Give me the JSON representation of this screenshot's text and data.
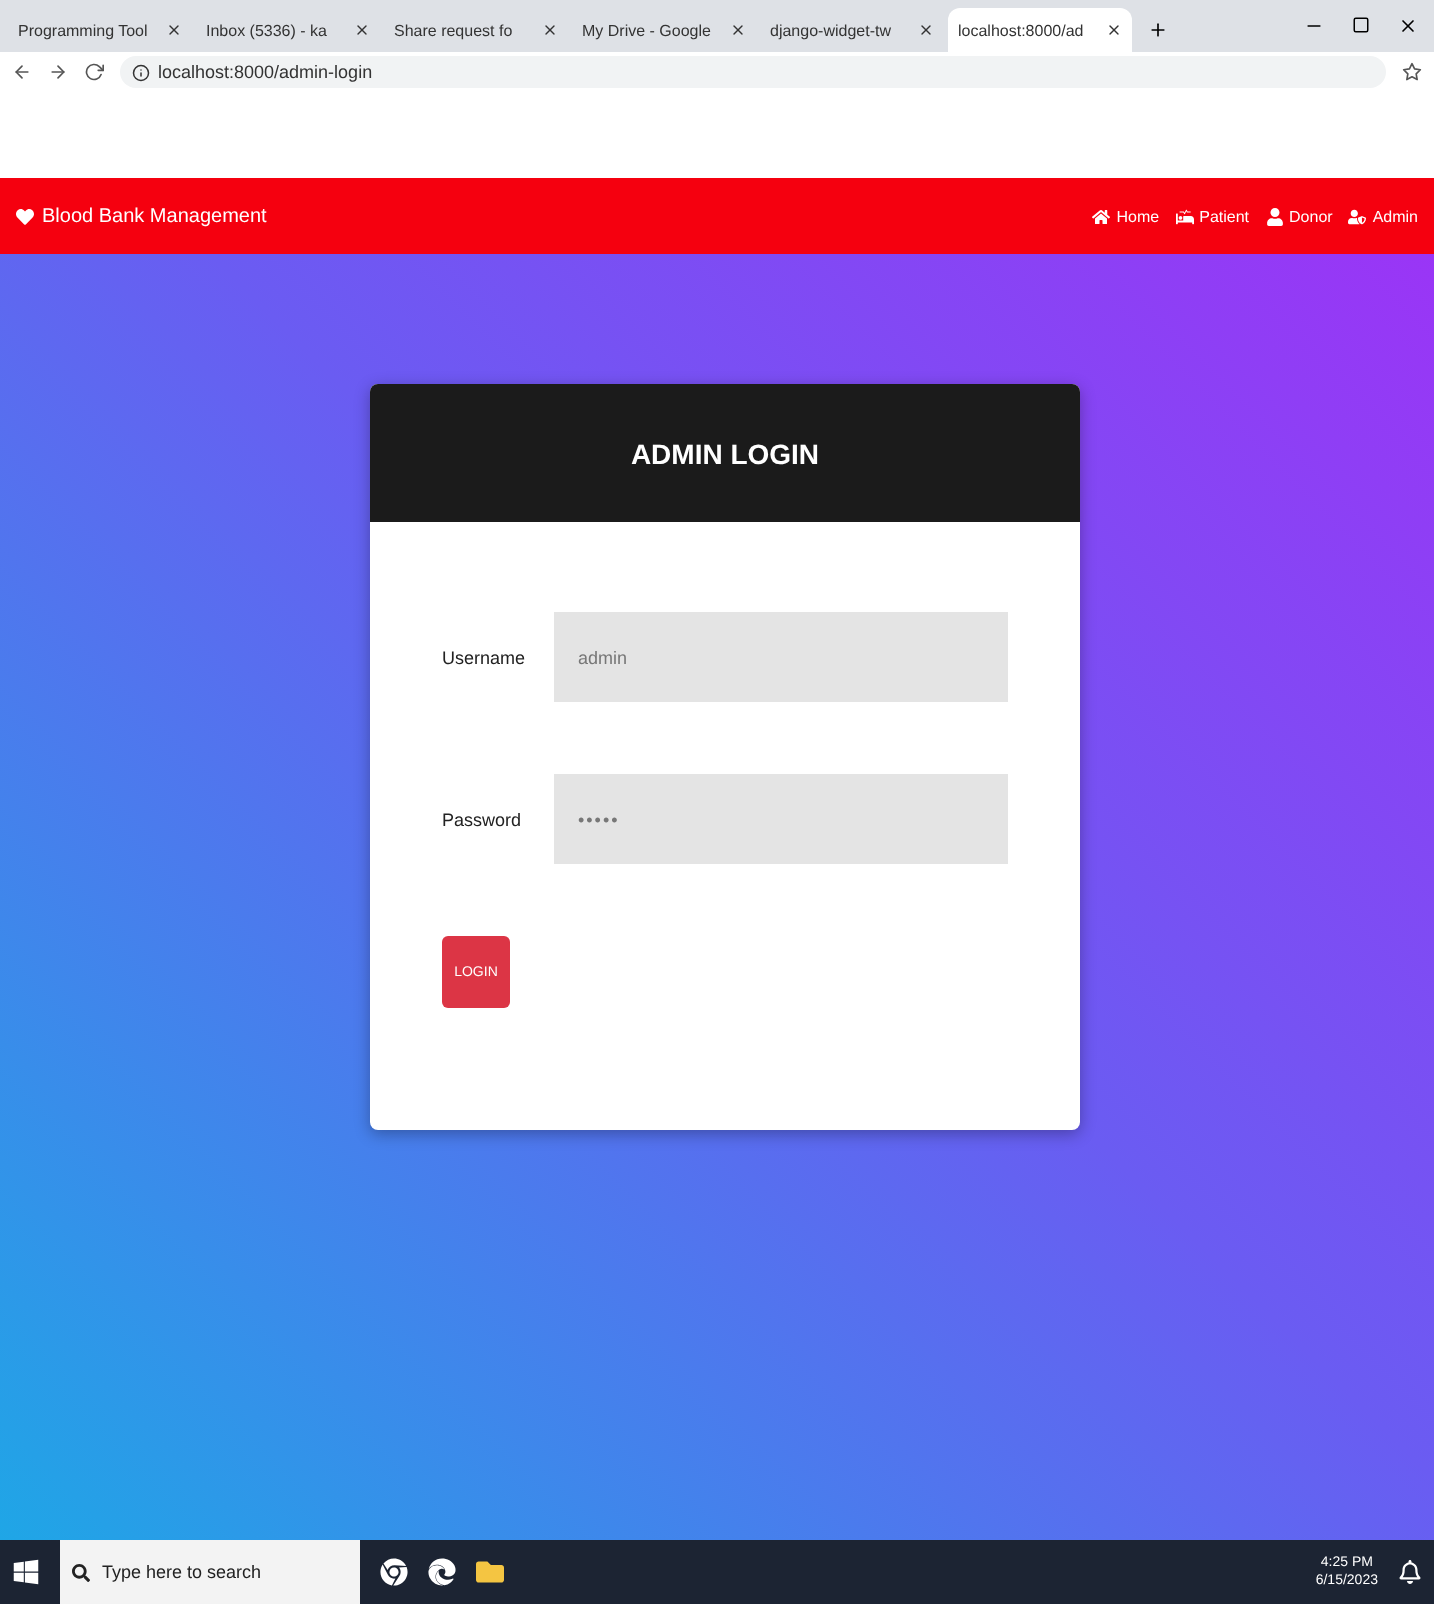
{
  "browser": {
    "tabs": [
      {
        "label": "Programming Tool",
        "selected": false
      },
      {
        "label": "Inbox (5336) - ka",
        "selected": false
      },
      {
        "label": "Share request fo",
        "selected": false
      },
      {
        "label": "My Drive - Google",
        "selected": false
      },
      {
        "label": "django-widget-tw",
        "selected": false
      },
      {
        "label": "localhost:8000/ad",
        "selected": true
      }
    ],
    "address": "localhost:8000/admin-login"
  },
  "navbar": {
    "brand": "Blood Bank Management",
    "links": [
      {
        "label": "Home",
        "kind": "home"
      },
      {
        "label": "Patient",
        "kind": "patient"
      },
      {
        "label": "Donor",
        "kind": "donor"
      },
      {
        "label": "Admin",
        "kind": "admin"
      }
    ]
  },
  "login": {
    "title": "ADMIN LOGIN",
    "fields": [
      {
        "label": "Username",
        "value": "admin",
        "kind": "text"
      },
      {
        "label": "Password",
        "value": "•••••",
        "kind": "password"
      }
    ],
    "button": "LOGIN"
  },
  "taskbar": {
    "search_placeholder": "Type here to search",
    "time": "4:25 PM",
    "date": "6/15/2023"
  }
}
